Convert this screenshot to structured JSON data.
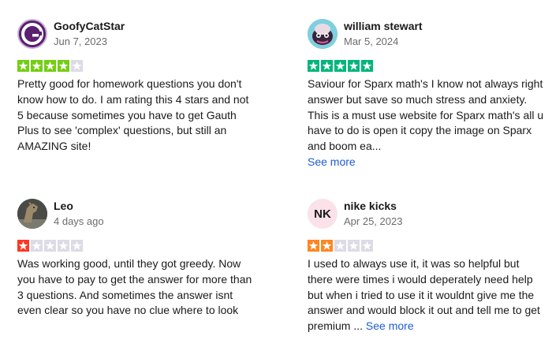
{
  "colors": {
    "star_green": "#73cf11",
    "star_bright_green": "#00b67a",
    "star_red": "#ff3722",
    "star_orange": "#ff8622",
    "star_empty": "#dcdce6",
    "link": "#1d5bd6"
  },
  "reviews": [
    {
      "author": "GoofyCatStar",
      "date": "Jun 7, 2023",
      "rating": 4,
      "avatar_icon": "goofycat-logo-icon",
      "text": "Pretty good for homework questions you don't know how to do. I am rating this 4 stars and not 5 because sometimes you have to get Gauth Plus to see 'complex' questions, but still an AMAZING site!",
      "see_more": ""
    },
    {
      "author": "william stewart",
      "date": "Mar 5, 2024",
      "rating": 5,
      "avatar_icon": "cartoon-creature-avatar-icon",
      "text": "Saviour for Sparx math's I know not always right answer but save so much stress and anxiety. This is a must use website for Sparx math's all u have to do is open it copy the image on Sparx and boom ea...",
      "see_more": "See more"
    },
    {
      "author": "Leo",
      "date": "4 days ago",
      "rating": 1,
      "avatar_icon": "horse-photo-avatar-icon",
      "text": "Was working good, until they got greedy. Now you have to pay to get the answer for more than 3 questions. And sometimes the answer isnt even clear so you have no clue where to look",
      "see_more": ""
    },
    {
      "author": "nike kicks",
      "date": "Apr 25, 2023",
      "rating": 2,
      "avatar_initials": "NK",
      "text": "I used to always use it, it was so helpful but there were times i would deperately need help but when i tried to use it it wouldnt give me the answer and would block it out and tell me to get premium ...",
      "see_more": "See more"
    }
  ]
}
